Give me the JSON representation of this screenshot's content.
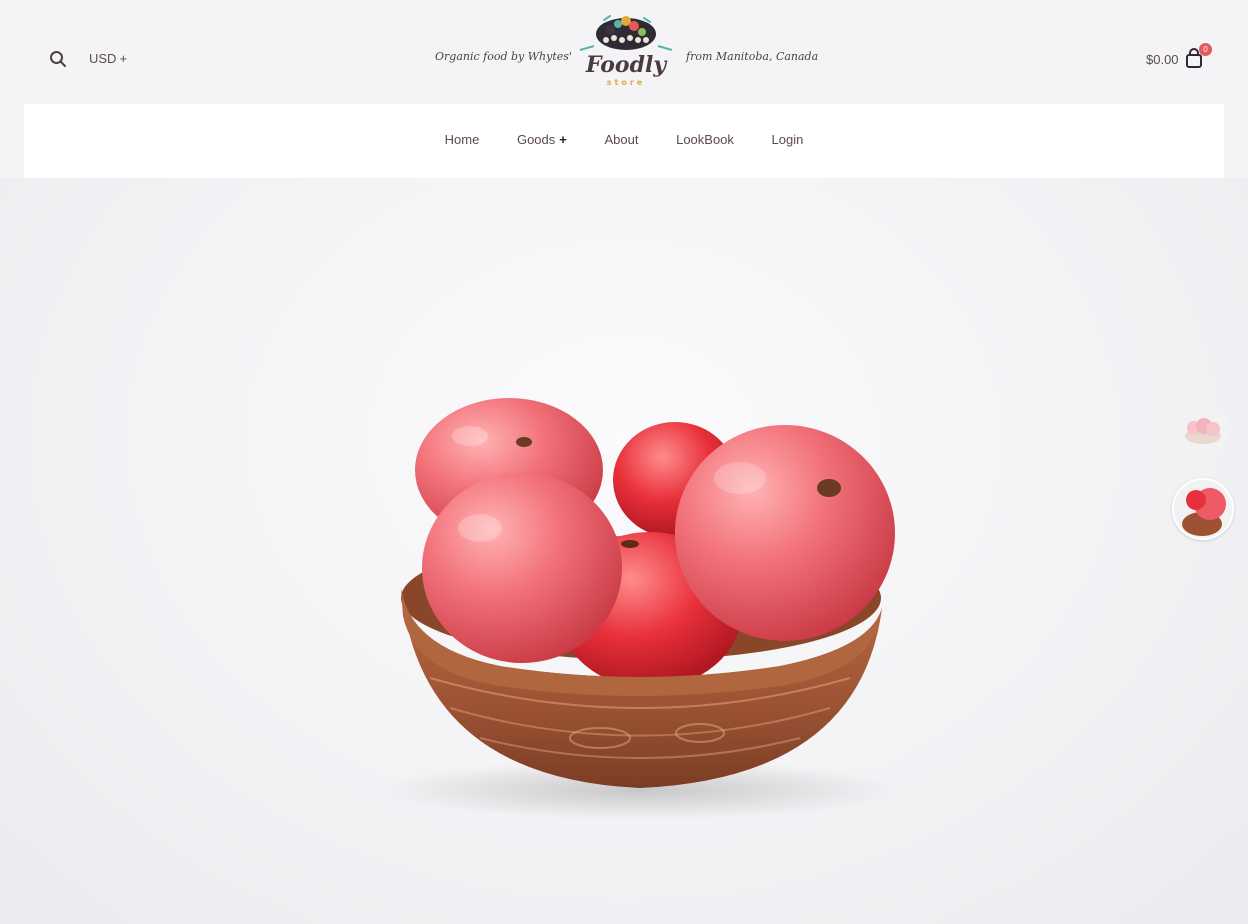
{
  "header": {
    "currency_label": "USD",
    "currency_toggle": "+",
    "tagline_left": "Organic food by Whytes'",
    "tagline_right": "from Manitoba, Canada",
    "logo_word": "Foodly",
    "logo_sub": "store",
    "cart_total": "$0.00",
    "cart_count": "0"
  },
  "nav": {
    "items": [
      {
        "label": "Home"
      },
      {
        "label": "Goods",
        "toggle": "+"
      },
      {
        "label": "About"
      },
      {
        "label": "LookBook"
      },
      {
        "label": "Login"
      }
    ]
  },
  "icons": {
    "search": "search-icon",
    "cart": "shopping-bag-icon"
  },
  "colors": {
    "accent": "#e25a5a",
    "text": "#5a4a52",
    "nav_bg": "#ffffff",
    "page_bg": "#f4f4f6"
  },
  "slider": {
    "slide_count": 2,
    "active_slide": 2
  }
}
